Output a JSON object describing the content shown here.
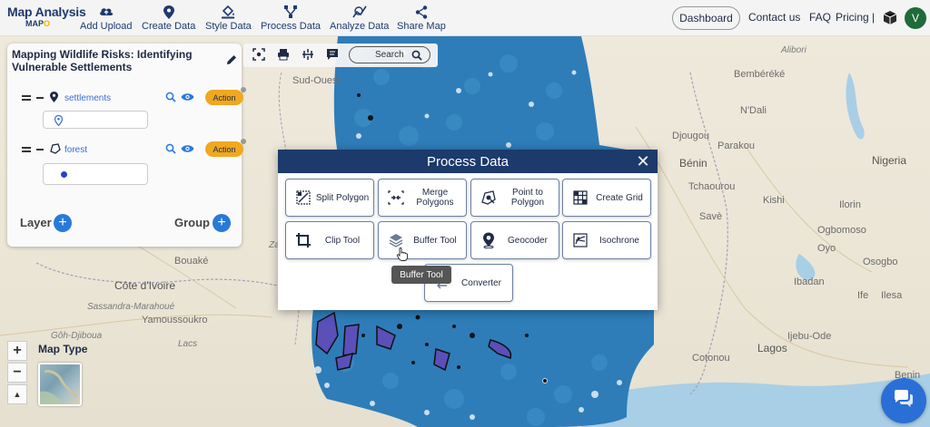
{
  "app": {
    "logo_title": "Map Analysis",
    "logo_sub_part1": "MAP",
    "logo_sub_part2": "O"
  },
  "nav": [
    {
      "label": "Add Upload",
      "icon": "cloud-upload-icon"
    },
    {
      "label": "Create Data",
      "icon": "map-pin-icon"
    },
    {
      "label": "Style Data",
      "icon": "paint-bucket-icon"
    },
    {
      "label": "Process Data",
      "icon": "process-nodes-icon"
    },
    {
      "label": "Analyze Data",
      "icon": "analyze-chart-icon"
    },
    {
      "label": "Share Map",
      "icon": "share-icon"
    }
  ],
  "header_right": {
    "dashboard": "Dashboard",
    "contact": "Contact us",
    "faq": "FAQ",
    "pricing": "Pricing |",
    "avatar_initial": "V"
  },
  "panel": {
    "title": "Mapping Wildlife Risks: Identifying Vulnerable Settlements",
    "layers": [
      {
        "name": "settlements",
        "action": "Action",
        "icon": "location-pin-icon"
      },
      {
        "name": "forest",
        "action": "Action",
        "icon": "polygon-icon"
      }
    ],
    "add_layer": "Layer",
    "add_group": "Group"
  },
  "map_toolbar": {
    "search_label": "Search"
  },
  "map_controls": {
    "zoom_in": "+",
    "zoom_out": "−",
    "north": "▲",
    "map_type_label": "Map Type"
  },
  "map_labels": [
    {
      "text": "Sud-Ouest"
    },
    {
      "text": "Bouaké"
    },
    {
      "text": "Côte d'Ivoire"
    },
    {
      "text": "Sassandra-Marahoué"
    },
    {
      "text": "Yamoussoukro"
    },
    {
      "text": "Lacs"
    },
    {
      "text": "Zanzan"
    },
    {
      "text": "Gôh-Djiboua"
    },
    {
      "text": "N'Dali"
    },
    {
      "text": "Djougou"
    },
    {
      "text": "Parakou"
    },
    {
      "text": "Bénin"
    },
    {
      "text": "Savè"
    },
    {
      "text": "Ilorin"
    },
    {
      "text": "Oyo"
    },
    {
      "text": "Ibadan"
    },
    {
      "text": "Osogbo"
    },
    {
      "text": "Ife"
    },
    {
      "text": "Ilesa"
    },
    {
      "text": "Ijebu-Ode"
    },
    {
      "text": "Lagos"
    },
    {
      "text": "Cotonou"
    },
    {
      "text": "Kishi"
    },
    {
      "text": "Ogbomoso"
    },
    {
      "text": "Bembéréké"
    },
    {
      "text": "Alibori"
    },
    {
      "text": "Tchaourou"
    },
    {
      "text": "Nigeria"
    },
    {
      "text": "Benin"
    }
  ],
  "dialog": {
    "title": "Process Data",
    "close": "✕",
    "tools": [
      {
        "label": "Split Polygon",
        "icon": "split-polygon-icon"
      },
      {
        "label": "Merge Polygons",
        "icon": "merge-polygons-icon"
      },
      {
        "label": "Point to Polygon",
        "icon": "point-to-polygon-icon"
      },
      {
        "label": "Create Grid",
        "icon": "grid-icon"
      },
      {
        "label": "Clip Tool",
        "icon": "crop-icon"
      },
      {
        "label": "Buffer Tool",
        "icon": "layers-icon"
      },
      {
        "label": "Geocoder",
        "icon": "geocoder-pin-icon"
      },
      {
        "label": "Isochrone",
        "icon": "isochrone-icon"
      },
      {
        "label": "Converter",
        "icon": "converter-icon"
      }
    ],
    "tooltip": "Buffer Tool"
  },
  "colors": {
    "brand_navy": "#1c3a6b",
    "action_orange": "#f0a820",
    "map_blue": "#2e7db9",
    "add_blue": "#2979d9",
    "avatar_green": "#1f6b3a"
  }
}
